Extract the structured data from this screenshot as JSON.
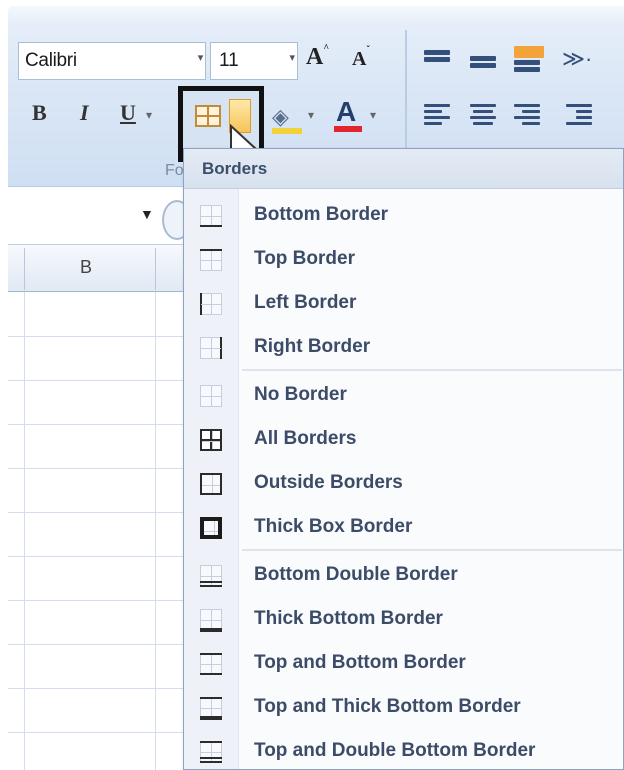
{
  "ribbon": {
    "font_name": "Calibri",
    "font_size": "11",
    "grow_font_letter": "A",
    "shrink_font_letter": "A",
    "bold_label": "B",
    "italic_label": "I",
    "underline_label": "U",
    "font_color_letter": "A",
    "font_group_label": "Fo",
    "accent_colors": {
      "highlight": "#f2a33a",
      "font_color_bar": "#e0262a",
      "fill_bar": "#f1d23a"
    }
  },
  "sheet": {
    "column_header": "B"
  },
  "borders_menu": {
    "title": "Borders",
    "items": [
      {
        "label": "Bottom Border",
        "icon": "bottom-border-icon"
      },
      {
        "label": "Top Border",
        "icon": "top-border-icon"
      },
      {
        "label": "Left Border",
        "icon": "left-border-icon"
      },
      {
        "label": "Right Border",
        "icon": "right-border-icon"
      },
      {
        "label": "No Border",
        "icon": "no-border-icon"
      },
      {
        "label": "All Borders",
        "icon": "all-borders-icon"
      },
      {
        "label": "Outside Borders",
        "icon": "outside-borders-icon"
      },
      {
        "label": "Thick Box Border",
        "icon": "thick-box-border-icon"
      },
      {
        "label": "Bottom Double Border",
        "icon": "bottom-double-border-icon"
      },
      {
        "label": "Thick Bottom Border",
        "icon": "thick-bottom-border-icon"
      },
      {
        "label": "Top and Bottom Border",
        "icon": "top-and-bottom-border-icon"
      },
      {
        "label": "Top and Thick Bottom Border",
        "icon": "top-and-thick-bottom-border-icon"
      },
      {
        "label": "Top and Double Bottom Border",
        "icon": "top-and-double-bottom-border-icon"
      }
    ]
  }
}
